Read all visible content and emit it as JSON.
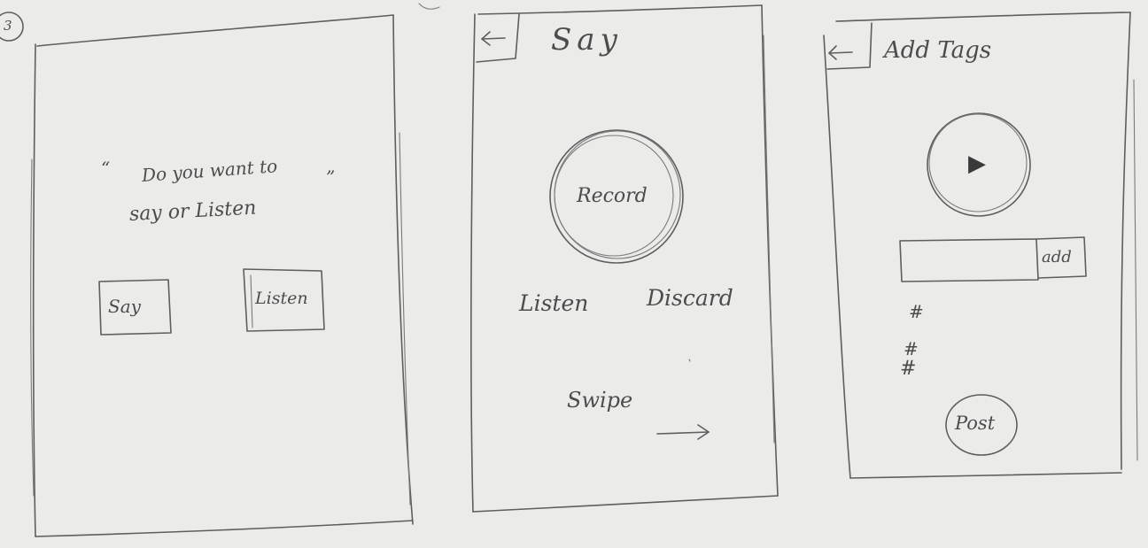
{
  "screen1": {
    "step": "3",
    "prompt_open_quote": "“",
    "prompt_line1": "Do you want to",
    "prompt_close_quote": "”",
    "prompt_line2": "say or Listen",
    "say_button": "Say",
    "listen_button": "Listen"
  },
  "screen2": {
    "back_icon": "back-arrow-icon",
    "title": "Say",
    "record_button": "Record",
    "listen_action": "Listen",
    "discard_action": "Discard",
    "swipe_hint": "Swipe",
    "swipe_icon": "right-arrow-icon"
  },
  "screen3": {
    "back_icon": "back-arrow-icon",
    "title": "Add Tags",
    "play_icon": "play-icon",
    "add_button": "add",
    "tags": [
      "#",
      "#",
      "#"
    ],
    "post_button": "Post"
  }
}
